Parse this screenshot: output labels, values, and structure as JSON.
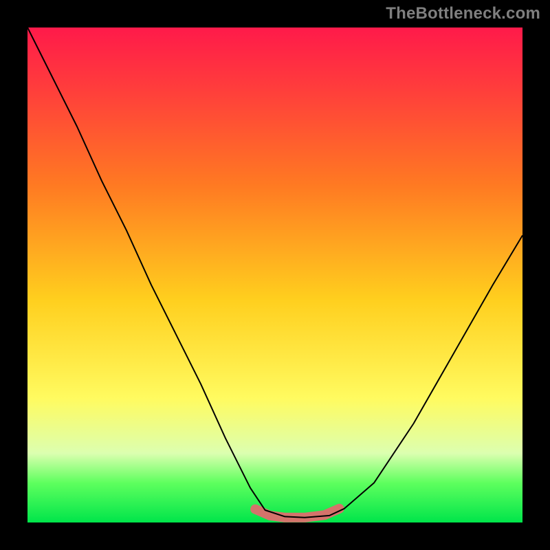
{
  "watermark": "TheBottleneck.com",
  "chart_data": {
    "type": "line",
    "title": "",
    "xlabel": "",
    "ylabel": "",
    "xlim": [
      0,
      1
    ],
    "ylim": [
      0,
      1
    ],
    "grid": false,
    "legend": false,
    "series": [
      {
        "name": "v-curve",
        "stroke": "#000000",
        "stroke_width": 2,
        "x": [
          0.0,
          0.05,
          0.1,
          0.15,
          0.2,
          0.25,
          0.3,
          0.35,
          0.4,
          0.45,
          0.48,
          0.52,
          0.56,
          0.61,
          0.64,
          0.7,
          0.78,
          0.86,
          0.94,
          1.0
        ],
        "y": [
          1.0,
          0.9,
          0.8,
          0.69,
          0.59,
          0.48,
          0.38,
          0.28,
          0.17,
          0.07,
          0.025,
          0.012,
          0.01,
          0.014,
          0.028,
          0.08,
          0.2,
          0.34,
          0.48,
          0.58
        ]
      },
      {
        "name": "trough-highlight",
        "stroke": "#d4736b",
        "stroke_width": 14,
        "linecap": "round",
        "x": [
          0.46,
          0.49,
          0.52,
          0.56,
          0.6,
          0.63
        ],
        "y": [
          0.027,
          0.014,
          0.01,
          0.01,
          0.015,
          0.028
        ]
      }
    ],
    "background_gradient_stops": [
      {
        "pos": 0.0,
        "color": "#ff1a4a"
      },
      {
        "pos": 0.12,
        "color": "#ff3c3c"
      },
      {
        "pos": 0.32,
        "color": "#ff7a22"
      },
      {
        "pos": 0.55,
        "color": "#ffcf1e"
      },
      {
        "pos": 0.75,
        "color": "#fffb60"
      },
      {
        "pos": 0.86,
        "color": "#dcffb0"
      },
      {
        "pos": 0.92,
        "color": "#5eff5e"
      },
      {
        "pos": 1.0,
        "color": "#00e54a"
      }
    ]
  }
}
